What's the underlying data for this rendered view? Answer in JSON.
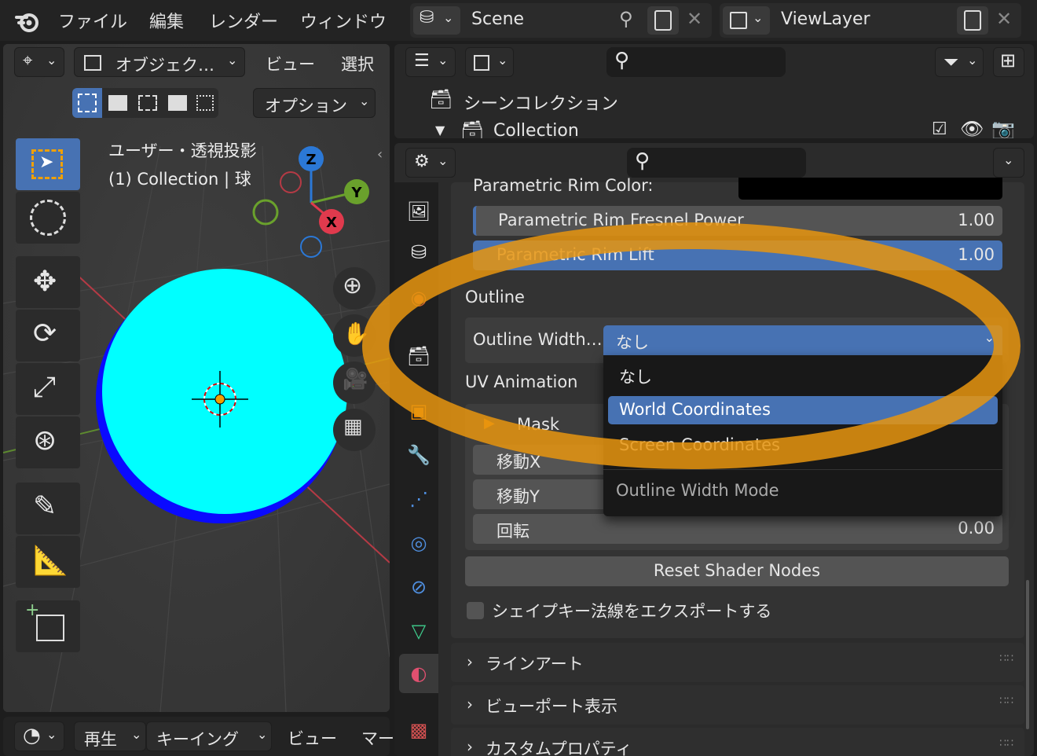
{
  "topbar": {
    "menu": [
      "ファイル",
      "編集",
      "レンダー",
      "ウィンドウ"
    ],
    "scene_name": "Scene",
    "viewlayer_name": "ViewLayer"
  },
  "viewport": {
    "header": {
      "mode_label": "オブジェク…",
      "view_label": "ビュー",
      "select_label": "選択",
      "options_label": "オプション"
    },
    "overlay_text": {
      "view_name": "ユーザー・透視投影",
      "object_info": "(1) Collection | 球"
    },
    "gizmo": {
      "x": "X",
      "y": "Y",
      "z": "Z"
    },
    "tools": [
      "select-box",
      "cursor",
      "move",
      "rotate",
      "scale",
      "transform",
      "annotate",
      "measure",
      "add-cube"
    ],
    "sphere_colors": {
      "top": "#00ffff",
      "side": "#0a0aff"
    }
  },
  "outliner": {
    "root_label": "シーンコレクション",
    "collection_label": "Collection"
  },
  "properties": {
    "rim_color_label": "Parametric Rim Color:",
    "rim_fresnel_label": "Parametric Rim Fresnel Power",
    "rim_fresnel_value": "1.00",
    "rim_lift_label": "Parametric Rim Lift",
    "rim_lift_value": "1.00",
    "outline_section": "Outline",
    "outline_width_label": "Outline Width…",
    "outline_width_value": "なし",
    "uv_animation_section": "UV Animation",
    "mask_label": "Mask",
    "move_x_label": "移動X",
    "move_y_label": "移動Y",
    "rotate_label": "回転",
    "rotate_value": "0.00",
    "reset_button": "Reset Shader Nodes",
    "export_checkbox": "シェイプキー法線をエクスポートする",
    "panels": [
      "ラインアート",
      "ビューポート表示",
      "カスタムプロパティ"
    ]
  },
  "dropdown": {
    "options": [
      "なし",
      "World Coordinates",
      "Screen Coordinates"
    ],
    "highlighted": "World Coordinates",
    "tooltip": "Outline Width Mode"
  },
  "timeline": {
    "playback_label": "再生",
    "keying_label": "キーイング",
    "view_label": "ビュー",
    "marker_label": "マー"
  },
  "colors": {
    "accent": "#4772b3",
    "highlight_ring": "#e8950f"
  }
}
